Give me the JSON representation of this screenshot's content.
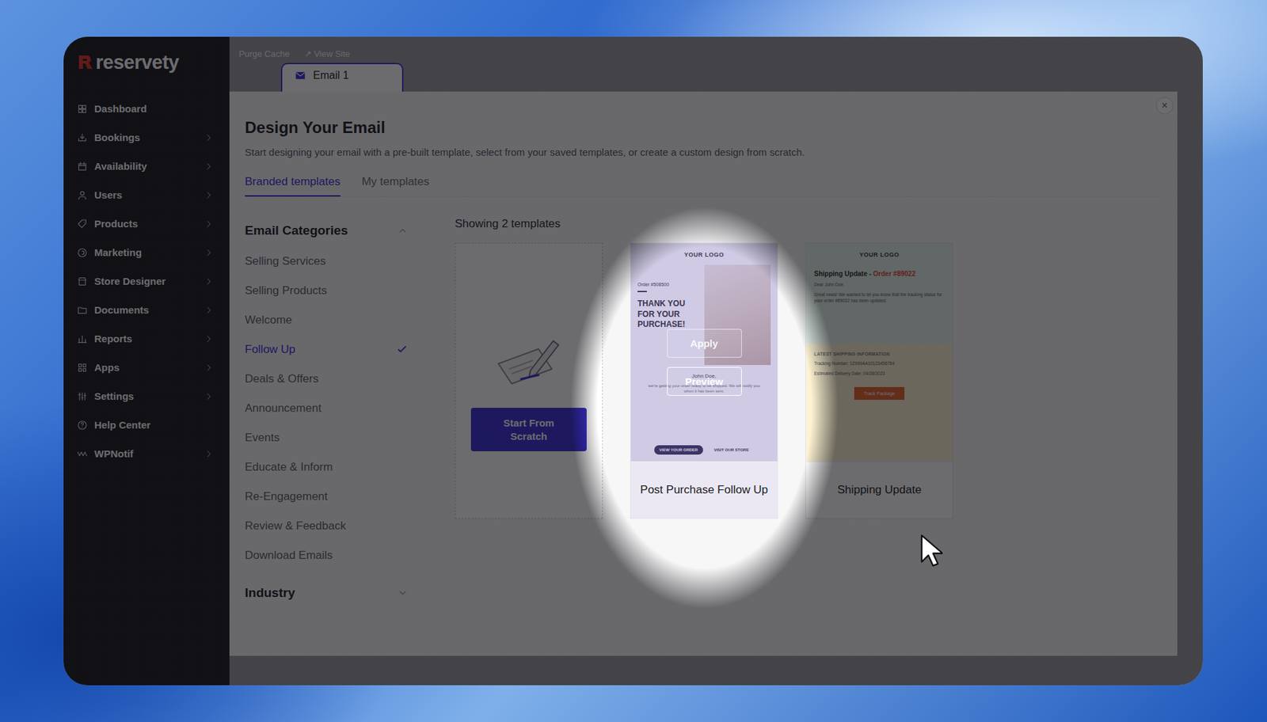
{
  "app": {
    "logo": "reservety",
    "topbar": [
      "Purge Cache",
      "↗ View Site"
    ],
    "page_tab": "Email 1"
  },
  "sidebar": {
    "items": [
      {
        "label": "Dashboard",
        "has_submenu": false
      },
      {
        "label": "Bookings",
        "has_submenu": true
      },
      {
        "label": "Availability",
        "has_submenu": true
      },
      {
        "label": "Users",
        "has_submenu": true
      },
      {
        "label": "Products",
        "has_submenu": true
      },
      {
        "label": "Marketing",
        "has_submenu": true
      },
      {
        "label": "Store Designer",
        "has_submenu": true
      },
      {
        "label": "Documents",
        "has_submenu": true
      },
      {
        "label": "Reports",
        "has_submenu": true
      },
      {
        "label": "Apps",
        "has_submenu": true
      },
      {
        "label": "Settings",
        "has_submenu": true
      },
      {
        "label": "Help Center",
        "has_submenu": false
      },
      {
        "label": "WPNotif",
        "has_submenu": true
      }
    ]
  },
  "modal": {
    "title": "Design Your Email",
    "subtitle": "Start designing your email with a pre-built template, select from your saved templates, or create a custom design from scratch.",
    "close": "×",
    "tabs": [
      {
        "label": "Branded templates",
        "selected": true
      },
      {
        "label": "My templates",
        "selected": false
      }
    ],
    "filters": [
      {
        "title": "Email Categories",
        "expanded": true,
        "items": [
          {
            "label": "Selling Services",
            "selected": false
          },
          {
            "label": "Selling Products",
            "selected": false
          },
          {
            "label": "Welcome",
            "selected": false
          },
          {
            "label": "Follow Up",
            "selected": true
          },
          {
            "label": "Deals & Offers",
            "selected": false
          },
          {
            "label": "Announcement",
            "selected": false
          },
          {
            "label": "Events",
            "selected": false
          },
          {
            "label": "Educate & Inform",
            "selected": false
          },
          {
            "label": "Re-Engagement",
            "selected": false
          },
          {
            "label": "Review & Feedback",
            "selected": false
          },
          {
            "label": "Download Emails",
            "selected": false
          }
        ]
      },
      {
        "title": "Industry",
        "expanded": false,
        "items": []
      }
    ],
    "count": "Showing 2 templates",
    "scratch_button": "Start From Scratch",
    "templates": [
      {
        "kind": "purchase",
        "name": "Post Purchase Follow Up",
        "hovered": true,
        "actions": [
          "Apply",
          "Preview"
        ],
        "preview": {
          "logo": "YOUR LOGO",
          "order": "Order #508500",
          "heading": "THANK YOU FOR YOUR PURCHASE!",
          "greeting": "John Doe,",
          "body": "we're getting your order ready to be shipped. We will notify you when it has been sent.",
          "buttons": [
            "VIEW YOUR ORDER",
            "VISIT OUR STORE"
          ]
        }
      },
      {
        "kind": "shipping",
        "name": "Shipping Update",
        "hovered": false,
        "actions": [],
        "preview": {
          "logo": "YOUR LOGO",
          "heading": "Shipping Update - ",
          "heading_accent": "Order #89022",
          "greeting": "Dear John Doe,",
          "body": "Great news! We wanted to let you know that the tracking status for your order #89022 has been updated.",
          "section": "LATEST SHIPPING INFORMATION",
          "tracking": "Tracking Number: 1Z999AA10123456784",
          "delivery": "Estimated Delivery Date: 04/28/2023",
          "buttons": [
            "Track Package"
          ]
        }
      }
    ]
  },
  "spotlight": {
    "on": true
  }
}
